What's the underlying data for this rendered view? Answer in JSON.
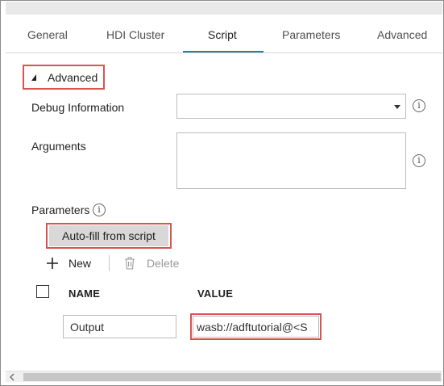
{
  "tabs": [
    {
      "label": "General"
    },
    {
      "label": "HDI Cluster"
    },
    {
      "label": "Script"
    },
    {
      "label": "Parameters"
    },
    {
      "label": "Advanced"
    }
  ],
  "active_tab": "Script",
  "advanced": {
    "label": "Advanced"
  },
  "debug": {
    "label": "Debug Information",
    "value": ""
  },
  "arguments": {
    "label": "Arguments",
    "value": ""
  },
  "parameters": {
    "label": "Parameters"
  },
  "autofill": {
    "label": "Auto-fill from script"
  },
  "toolbar": {
    "new_label": "New",
    "delete_label": "Delete"
  },
  "table": {
    "columns": [
      "NAME",
      "VALUE"
    ],
    "rows": [
      {
        "name": "Output",
        "value": "wasb://adftutorial@<S"
      }
    ]
  },
  "icons": {
    "info": "info-icon",
    "plus": "plus-icon",
    "trash": "trash-icon",
    "collapse": "collapse-triangle-icon",
    "dropdown": "chevron-down-icon",
    "scroll_left": "scroll-left-icon"
  },
  "colors": {
    "accent": "#2f7d9b",
    "highlight": "#d9534f"
  }
}
